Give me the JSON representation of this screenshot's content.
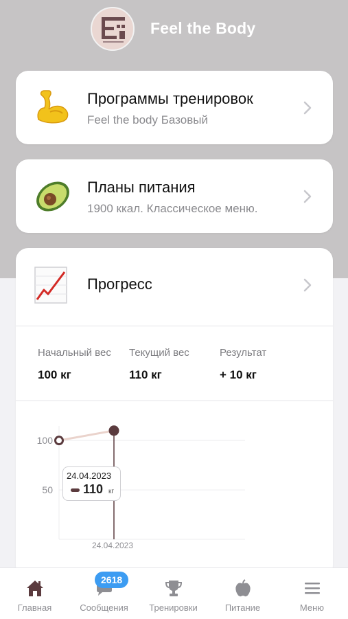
{
  "header": {
    "app_title": "Feel the Body",
    "avatar_icon": "brand-logo-icon"
  },
  "cards": [
    {
      "icon": "flexed-biceps-icon",
      "title": "Программы тренировок",
      "subtitle": "Feel the body Базовый"
    },
    {
      "icon": "avocado-icon",
      "title": "Планы питания",
      "subtitle": "1900 ккал. Классическое меню."
    }
  ],
  "progress": {
    "icon": "chart-increasing-icon",
    "title": "Прогресс",
    "stats": [
      {
        "label": "Начальный вес",
        "value": "100 кг"
      },
      {
        "label": "Текущий вес",
        "value": "110 кг"
      },
      {
        "label": "Результат",
        "value": "+ 10 кг"
      }
    ]
  },
  "chart_data": {
    "type": "line",
    "y_ticks": [
      "100",
      "50"
    ],
    "ylim": [
      0,
      130
    ],
    "x_tick_label": "24.04.2023",
    "series": [
      {
        "points": [
          {
            "x": 0,
            "y": 100
          },
          {
            "x": 1,
            "y": 110
          }
        ]
      }
    ],
    "tooltip": {
      "date": "24.04.2023",
      "value": "110",
      "unit": "кг"
    },
    "colors": {
      "line": "#ead3cc",
      "marker": "#5b3b3e",
      "cursor": "#5b3b3e"
    }
  },
  "tabbar": {
    "tabs": [
      {
        "icon": "home-icon",
        "label": "Главная",
        "active": true
      },
      {
        "icon": "chat-icon",
        "label": "Сообщения"
      },
      {
        "icon": "trophy-icon",
        "label": "Тренировки"
      },
      {
        "icon": "apple-icon",
        "label": "Питание"
      },
      {
        "icon": "hamburger-menu-icon",
        "label": "Меню"
      }
    ],
    "messages_badge": "2618"
  },
  "colors": {
    "top_background": "#c6c4c5",
    "badge": "#3c9cf2",
    "active_tab": "#5b3b3e",
    "inactive_tab": "#8e8e93"
  }
}
